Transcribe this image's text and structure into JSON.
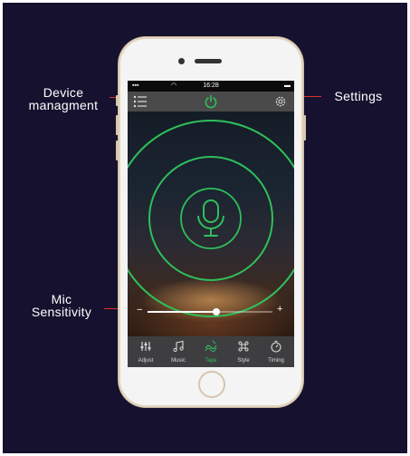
{
  "callouts": {
    "device_line1": "Device",
    "device_line2": "managment",
    "settings": "Settings",
    "mic_line1": "Mic",
    "mic_line2": "Sensitivity"
  },
  "status_bar": {
    "time": "16:28"
  },
  "mic_sensitivity": {
    "level_percent": 55,
    "minus": "−",
    "plus": "+"
  },
  "tabs": [
    {
      "label": "Adjust",
      "icon": "equalizer-icon"
    },
    {
      "label": "Music",
      "icon": "music-note-icon"
    },
    {
      "label": "Tape",
      "icon": "tape-icon",
      "active": true
    },
    {
      "label": "Style",
      "icon": "command-icon"
    },
    {
      "label": "Timing",
      "icon": "timer-icon"
    }
  ],
  "colors": {
    "accent_green": "#2fbf5a",
    "callout_red": "#d9322b",
    "background": "#16112e"
  }
}
